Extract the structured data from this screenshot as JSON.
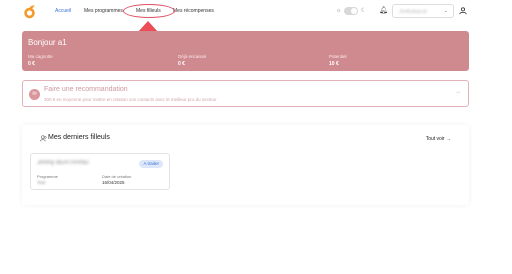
{
  "nav": {
    "items": [
      {
        "label": "Accueil",
        "active": true
      },
      {
        "label": "Mes programmes",
        "active": false
      },
      {
        "label": "Mes filleuls",
        "active": false
      },
      {
        "label": "Mes récompenses",
        "active": false
      }
    ],
    "account_name": "Jimfbalepcal"
  },
  "banner": {
    "greeting": "Bonjour a1",
    "stats": [
      {
        "label": "Ma cagnotte",
        "value": "0 €"
      },
      {
        "label": "Déjà encaissé",
        "value": "0 €"
      },
      {
        "label": "Potentiel",
        "value": "10 €"
      }
    ]
  },
  "recommendation": {
    "title": "Faire une recommandation",
    "subtitle": "300 € en moyenne pour mettre en relation vos contacts avec le meilleur pro du secteur"
  },
  "filleuls": {
    "title": "Mes derniers filleuls",
    "see_all": "Tout voir",
    "cards": [
      {
        "name": "Jimmy BERTRAND",
        "status": "A traiter",
        "programme_label": "Programme",
        "programme_value": "Test",
        "date_label": "Date de création",
        "date_value": "16/04/2025"
      }
    ]
  },
  "colors": {
    "accent": "#3b6fd6",
    "banner": "#cf8a90",
    "annotation": "#e05064"
  },
  "icons": [
    "logo-icon",
    "sun-icon",
    "moon-icon",
    "bell-icon",
    "chevron-down-icon",
    "user-icon",
    "people-icon",
    "arrow-right-icon"
  ]
}
